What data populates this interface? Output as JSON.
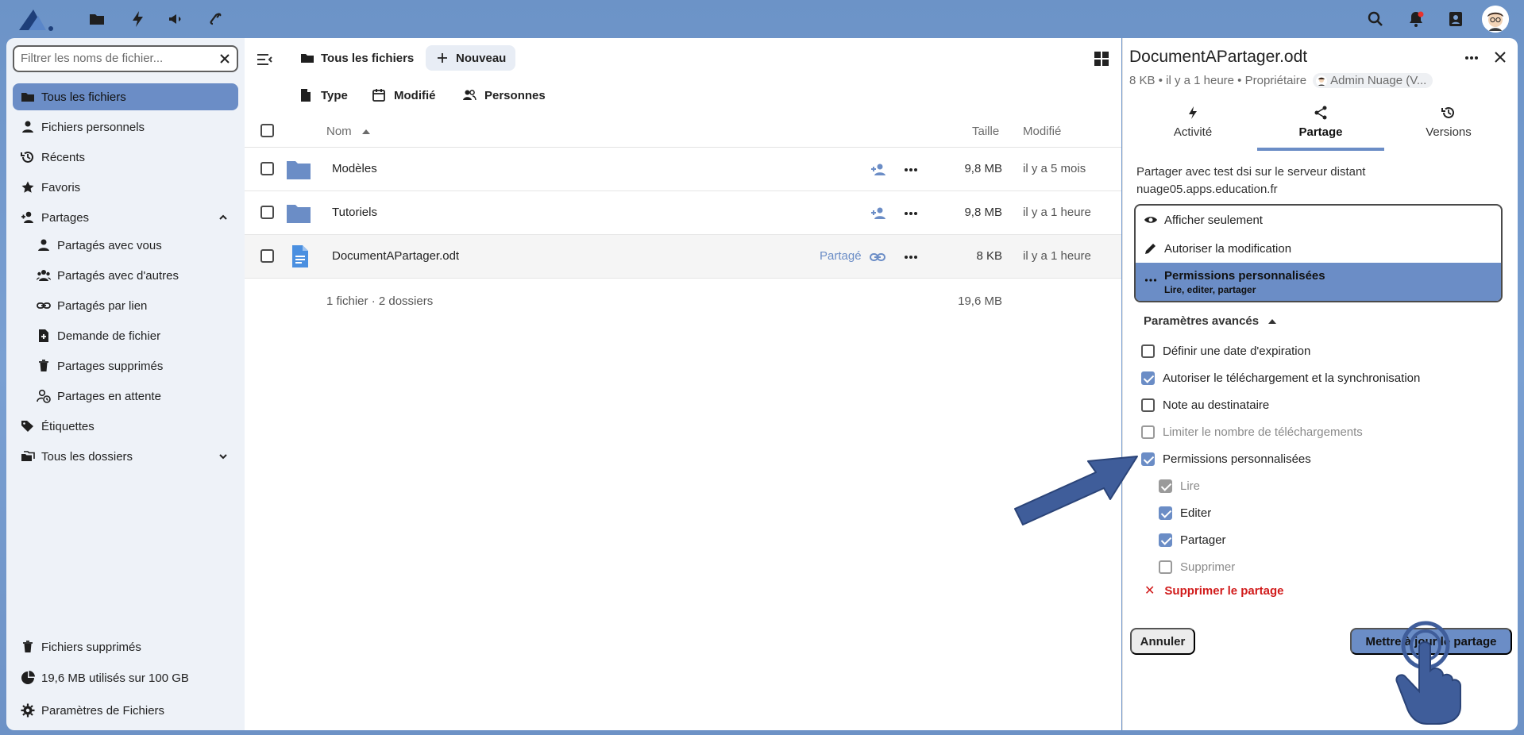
{
  "topbar": {
    "apps": [
      "files-icon",
      "activity-icon",
      "announcements-icon",
      "link-icon"
    ],
    "right": [
      "search-icon",
      "notifications-icon",
      "contacts-icon"
    ],
    "notification_dot_color": "#e9322d"
  },
  "sidebar": {
    "filter_placeholder": "Filtrer les noms de fichier...",
    "items": [
      {
        "label": "Tous les fichiers",
        "icon": "folder-icon",
        "active": true
      },
      {
        "label": "Fichiers personnels",
        "icon": "user-icon"
      },
      {
        "label": "Récents",
        "icon": "history-icon"
      },
      {
        "label": "Favoris",
        "icon": "star-icon"
      },
      {
        "label": "Partages",
        "icon": "share-user-icon"
      },
      {
        "label": "Partagés avec vous",
        "icon": "user-icon"
      },
      {
        "label": "Partagés avec d'autres",
        "icon": "users-icon"
      },
      {
        "label": "Partagés par lien",
        "icon": "link-icon"
      },
      {
        "label": "Demande de fichier",
        "icon": "file-request-icon"
      },
      {
        "label": "Partages supprimés",
        "icon": "trash-icon"
      },
      {
        "label": "Partages en attente",
        "icon": "pending-user-icon"
      },
      {
        "label": "Étiquettes",
        "icon": "tag-icon"
      },
      {
        "label": "Tous les dossiers",
        "icon": "folders-icon"
      }
    ],
    "footer": {
      "trash": "Fichiers supprimés",
      "quota": "19,6 MB utilisés sur 100 GB",
      "settings": "Paramètres de Fichiers"
    }
  },
  "main": {
    "breadcrumb": "Tous les fichiers",
    "new_button": "Nouveau",
    "filters": [
      "Type",
      "Modifié",
      "Personnes"
    ],
    "columns": {
      "name": "Nom",
      "size": "Taille",
      "modified": "Modifié"
    },
    "rows": [
      {
        "name": "Modèles",
        "type": "folder",
        "size": "9,8 MB",
        "modified": "il y a 5 mois"
      },
      {
        "name": "Tutoriels",
        "type": "folder",
        "size": "9,8 MB",
        "modified": "il y a 1 heure"
      },
      {
        "name": "DocumentAPartager.odt",
        "type": "document",
        "size": "8 KB",
        "modified": "il y a 1 heure",
        "shared_label": "Partagé"
      }
    ],
    "summary": "1 fichier · 2 dossiers",
    "summary_size": "19,6 MB"
  },
  "details": {
    "title": "DocumentAPartager.odt",
    "size": "8 KB",
    "modified": "il y a 1 heure",
    "owner_label": "Propriétaire",
    "owner_name": "Admin Nuage (V...",
    "tabs": [
      "Activité",
      "Partage",
      "Versions"
    ],
    "share_with": "Partager avec test dsi sur le serveur distant nuage05.apps.education.fr",
    "permissions": {
      "view_only": "Afficher seulement",
      "allow_edit": "Autoriser la modification",
      "custom": "Permissions personnalisées",
      "custom_sub": "Lire, editer, partager"
    },
    "advanced_label": "Paramètres avancés",
    "options": [
      {
        "label": "Définir une date d'expiration",
        "checked": false
      },
      {
        "label": "Autoriser le téléchargement et la synchronisation",
        "checked": true
      },
      {
        "label": "Note au destinataire",
        "checked": false
      },
      {
        "label": "Limiter le nombre de téléchargements",
        "checked": false,
        "disabled": true
      },
      {
        "label": "Permissions personnalisées",
        "checked": true
      }
    ],
    "sub_options": [
      {
        "label": "Lire",
        "checked": true,
        "disabled": true
      },
      {
        "label": "Editer",
        "checked": true
      },
      {
        "label": "Partager",
        "checked": true
      },
      {
        "label": "Supprimer",
        "checked": false,
        "disabled": true
      }
    ],
    "delete_share": "Supprimer le partage",
    "cancel_button": "Annuler",
    "update_button": "Mettre à jour le partage"
  },
  "colors": {
    "accent": "#6b8dc6",
    "danger": "#d11a1a",
    "overlay": "#3f5d9a"
  }
}
